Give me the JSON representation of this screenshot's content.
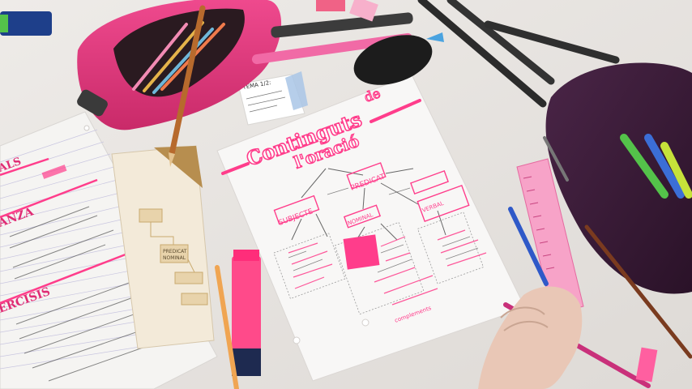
{
  "mindmap": {
    "title_line1": "Continguts",
    "title_word_de": "de",
    "title_line2": "l'oració",
    "node_predicat": "PREDICAT",
    "node_subjecte": "SUBJECTE",
    "node_predicat_nominal": "NOMINAL",
    "node_predicat_verbal": "VERBAL",
    "bottom_label": "complements"
  },
  "sticky_note": {
    "heading": "TEMA 1/2:"
  },
  "left_notes": {
    "heading_1": "ALS",
    "heading_2": "ANZA",
    "heading_3": "ERCISIS"
  },
  "tan_sheet": {
    "label_predicat": "PREDICAT",
    "label_nominal": "NOMINAL"
  },
  "colors": {
    "accent_pink": "#ff3d8b",
    "table": "#e9e6e3",
    "paper": "#f7f6f5",
    "pencil_case_pink": "#e0357a",
    "pencil_case_purple": "#3d1f3a"
  }
}
